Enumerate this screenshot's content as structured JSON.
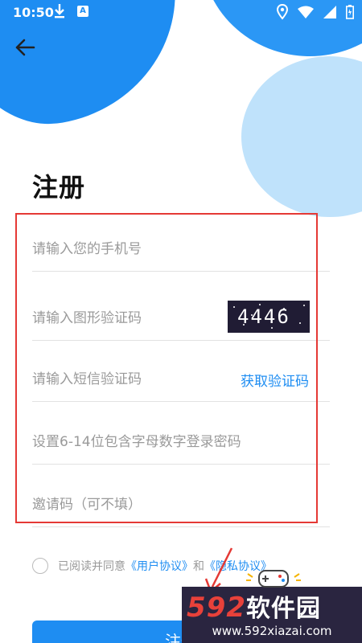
{
  "status_bar": {
    "time": "10:50",
    "a_badge": "A"
  },
  "page": {
    "title": "注册"
  },
  "form": {
    "phone_placeholder": "请输入您的手机号",
    "captcha_placeholder": "请输入图形验证码",
    "captcha_text": "4446",
    "sms_placeholder": "请输入短信验证码",
    "sms_button": "获取验证码",
    "password_placeholder": "设置6-14位包含字母数字登录密码",
    "invite_placeholder": "邀请码（可不填）"
  },
  "agreement": {
    "prefix": "已阅读并同意",
    "user_link": "《用户协议》",
    "and": "和",
    "privacy_link": "《隐私协议》"
  },
  "register_button": "注册",
  "watermark": {
    "logo_num": "592",
    "logo_cn": "软件园",
    "url": "www.592xiazai.com"
  },
  "colors": {
    "accent": "#1e8df2",
    "highlight": "#e53935"
  }
}
